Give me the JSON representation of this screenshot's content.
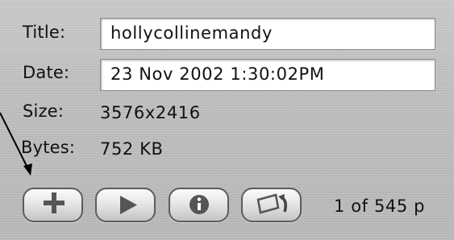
{
  "info": {
    "title_label": "Title:",
    "title_value": "hollycollinemandy",
    "date_label": "Date:",
    "date_value": "23 Nov 2002  1:30:02PM",
    "size_label": "Size:",
    "size_value": "3576x2416",
    "bytes_label": "Bytes:",
    "bytes_value": "752 KB"
  },
  "toolbar": {
    "buttons": [
      {
        "icon": "plus-icon"
      },
      {
        "icon": "play-icon"
      },
      {
        "icon": "info-icon"
      },
      {
        "icon": "rotate-icon"
      }
    ],
    "page_count": "1 of 545 p"
  }
}
